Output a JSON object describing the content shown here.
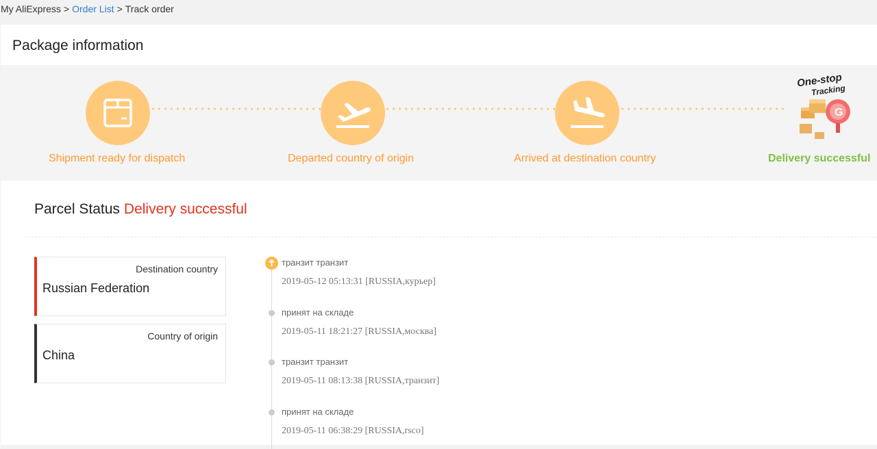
{
  "breadcrumb": {
    "root": "My AliExpress",
    "separator": ">",
    "order_list": "Order List",
    "current": "Track order"
  },
  "package": {
    "title": "Package information"
  },
  "steps": [
    {
      "label": "Shipment ready for dispatch",
      "icon": "box-icon"
    },
    {
      "label": "Departed country of origin",
      "icon": "plane-departure-icon"
    },
    {
      "label": "Arrived at destination country",
      "icon": "plane-arrival-icon"
    },
    {
      "label": "Delivery successful",
      "icon": "one-stop-tracking-badge"
    }
  ],
  "badge": {
    "line1": "One-stop",
    "line2": "Tracking"
  },
  "parcel": {
    "status_label": "Parcel Status",
    "status_value": "Delivery successful"
  },
  "destination": {
    "caption": "Destination country",
    "name": "Russian Federation"
  },
  "origin": {
    "caption": "Country of origin",
    "name": "China"
  },
  "events": [
    {
      "desc": "транзит транзит",
      "meta": "2019-05-12 05:13:31 [RUSSIA,курьер]"
    },
    {
      "desc": "принят на складе",
      "meta": "2019-05-11 18:21:27 [RUSSIA,москва]"
    },
    {
      "desc": "транзит транзит",
      "meta": "2019-05-11 08:13:38 [RUSSIA,транзит]"
    },
    {
      "desc": "принят на складе",
      "meta": "2019-05-11 06:38:29 [RUSSIA,rsco]"
    }
  ],
  "colors": {
    "accent_orange": "#ffc97c",
    "label_orange": "#ff9a2e",
    "success_green": "#7cc142",
    "status_red": "#e0331f",
    "link_blue": "#2f7bd6"
  }
}
